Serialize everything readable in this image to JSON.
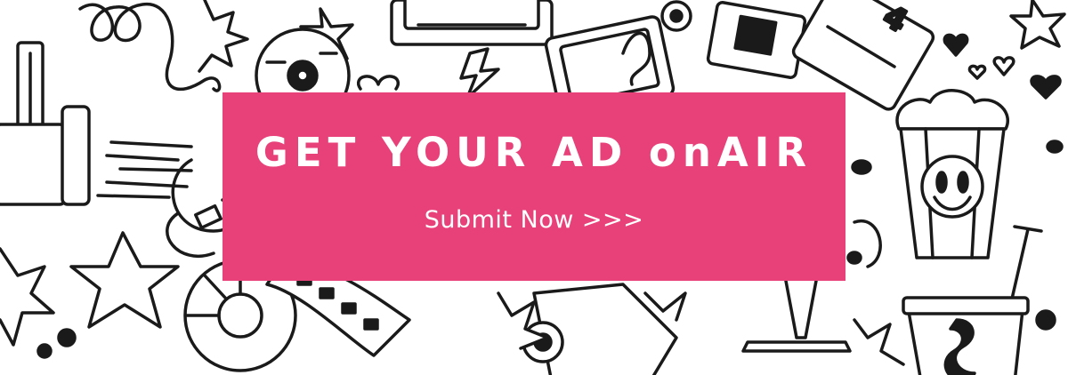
{
  "banner": {
    "headline": "GET YOUR AD onAIR",
    "cta_label": "Submit Now >>>"
  },
  "colors": {
    "accent": "#e8417a",
    "text_on_accent": "#ffffff",
    "doodle_ink": "#1a1a1a",
    "background": "#ffffff"
  },
  "icons": [
    "spotlight-icon",
    "film-reel-icon",
    "film-strip-icon",
    "star-icon",
    "lightning-icon",
    "ticket-icon",
    "popcorn-icon",
    "soda-cup-icon",
    "heart-icon",
    "squiggle-icon",
    "clapperboard-icon",
    "bow-icon"
  ]
}
